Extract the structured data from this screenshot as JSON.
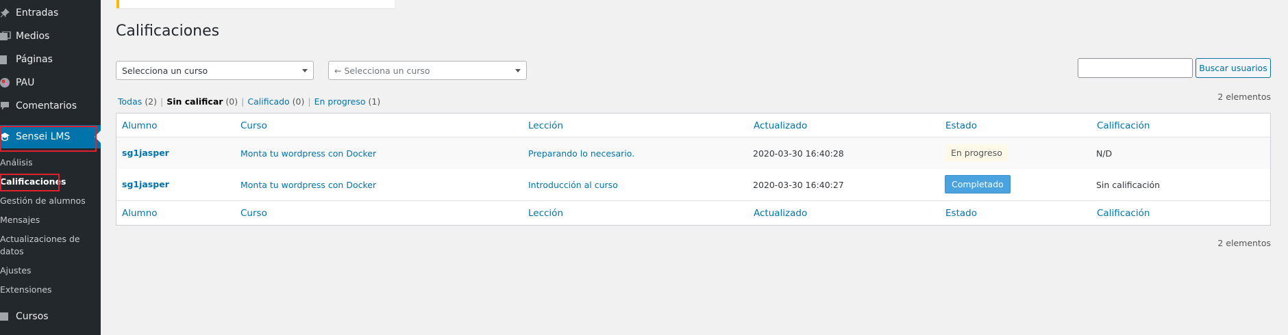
{
  "sidebar": {
    "menu": {
      "entradas": "Entradas",
      "medios": "Medios",
      "paginas": "Páginas",
      "pau": "PAU",
      "comentarios": "Comentarios",
      "sensei": "Sensei LMS",
      "cursos": "Cursos"
    },
    "submenu": {
      "analisis": "Análisis",
      "calificaciones": "Calificaciones",
      "gestion": "Gestión de alumnos",
      "mensajes": "Mensajes",
      "actualizaciones_line1": "Actualizaciones de",
      "actualizaciones_line2": "datos",
      "ajustes": "Ajustes",
      "extensiones": "Extensiones"
    }
  },
  "page": {
    "title": "Calificaciones"
  },
  "filters": {
    "course_select": "Selecciona un curso",
    "lesson_select": "← Selecciona un curso",
    "search_button": "Buscar usuarios",
    "search_value": ""
  },
  "views": {
    "todas": "Todas",
    "todas_count": "(2)",
    "sin_calificar": "Sin calificar",
    "sin_calificar_count": "(0)",
    "calificado": "Calificado",
    "calificado_count": "(0)",
    "en_progreso": "En progreso",
    "en_progreso_count": "(1)",
    "sep": "|"
  },
  "items_count": "2 elementos",
  "table": {
    "columns": {
      "alumno": "Alumno",
      "curso": "Curso",
      "leccion": "Lección",
      "actualizado": "Actualizado",
      "estado": "Estado",
      "calificacion": "Calificación"
    },
    "rows": [
      {
        "alumno": "sg1jasper",
        "curso": "Monta tu wordpress con Docker",
        "leccion": "Preparando lo necesario.",
        "actualizado": "2020-03-30 16:40:28",
        "estado": "En progreso",
        "calificacion": "N/D"
      },
      {
        "alumno": "sg1jasper",
        "curso": "Monta tu wordpress con Docker",
        "leccion": "Introducción al curso",
        "actualizado": "2020-03-30 16:40:27",
        "estado": "Completado",
        "calificacion": "Sin calificación"
      }
    ]
  },
  "colors": {
    "sidebar_bg": "#23282d",
    "accent": "#0073aa",
    "highlight": "#e0202d",
    "completed_badge": "#4aa3df",
    "progress_badge": "#fcf9e8"
  },
  "icons": [
    "pushpin-icon",
    "media-icon",
    "page-icon",
    "pau-icon",
    "comment-icon",
    "sensei-icon",
    "courses-icon",
    "dropdown-arrow-icon"
  ]
}
